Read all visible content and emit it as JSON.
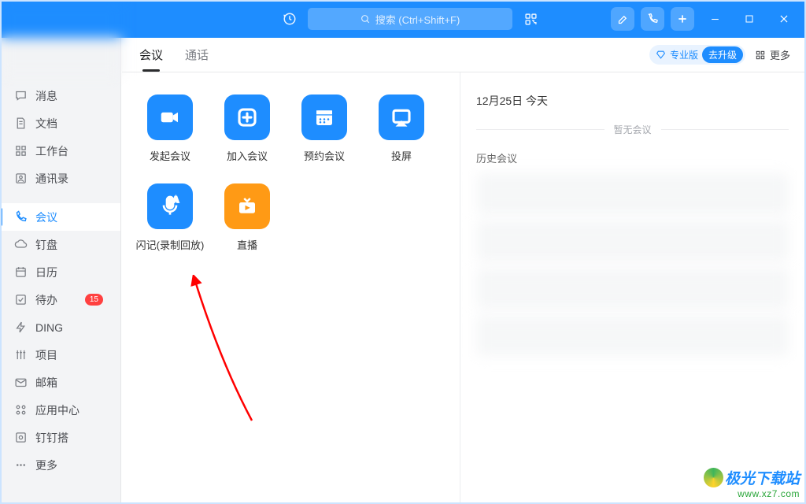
{
  "titlebar": {
    "search_placeholder": "搜索 (Ctrl+Shift+F)"
  },
  "sidebar": {
    "items": [
      {
        "label": "消息",
        "name": "nav-messages"
      },
      {
        "label": "文档",
        "name": "nav-docs"
      },
      {
        "label": "工作台",
        "name": "nav-workbench"
      },
      {
        "label": "通讯录",
        "name": "nav-contacts"
      },
      {
        "label": "会议",
        "name": "nav-meeting",
        "active": true
      },
      {
        "label": "钉盘",
        "name": "nav-drive"
      },
      {
        "label": "日历",
        "name": "nav-calendar"
      },
      {
        "label": "待办",
        "name": "nav-todo",
        "badge": "15"
      },
      {
        "label": "DING",
        "name": "nav-ding"
      },
      {
        "label": "项目",
        "name": "nav-project"
      },
      {
        "label": "邮箱",
        "name": "nav-mail"
      },
      {
        "label": "应用中心",
        "name": "nav-apps"
      },
      {
        "label": "钉钉搭",
        "name": "nav-build"
      },
      {
        "label": "更多",
        "name": "nav-more"
      }
    ]
  },
  "tabs": {
    "meeting": "会议",
    "call": "通话"
  },
  "pro": {
    "label": "专业版",
    "upgrade": "去升级"
  },
  "more": "更多",
  "cards": {
    "start": "发起会议",
    "join": "加入会议",
    "schedule": "预约会议",
    "cast": "投屏",
    "flashnote": "闪记(录制回放)",
    "live": "直播"
  },
  "right": {
    "today": "12月25日 今天",
    "empty": "暂无会议",
    "history": "历史会议"
  },
  "watermark": {
    "site": "极光下载站",
    "url": "www.xz7.com"
  }
}
